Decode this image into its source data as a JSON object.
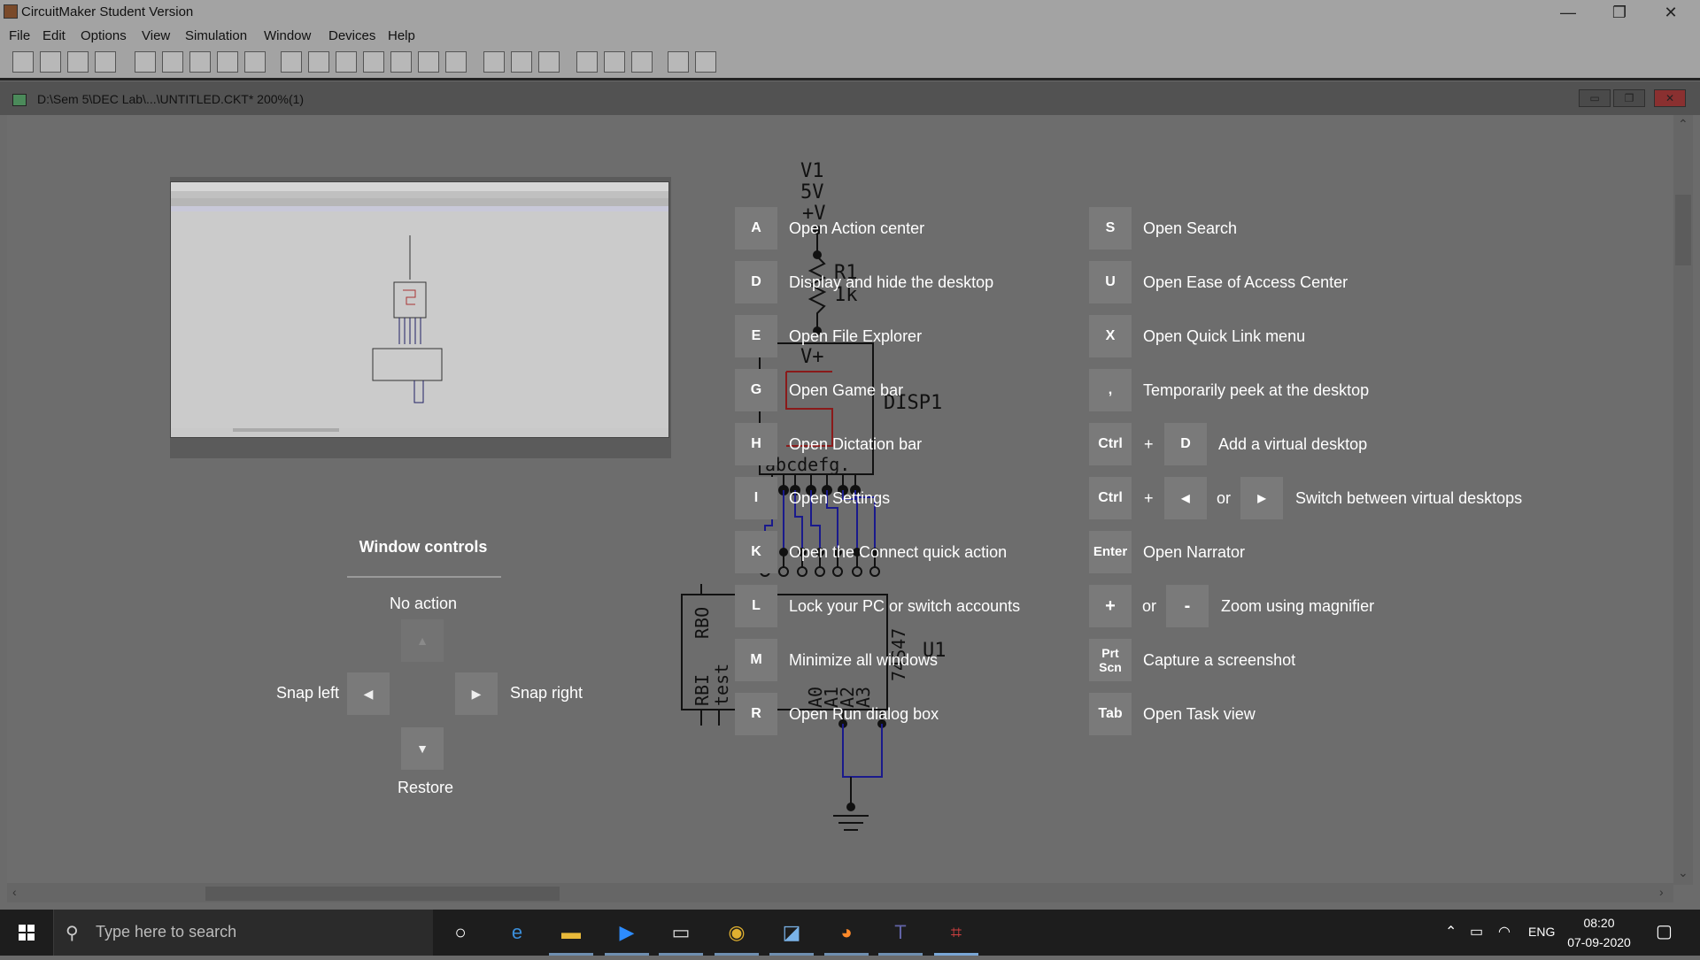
{
  "app": {
    "title": "CircuitMaker Student Version",
    "window_buttons": {
      "minimize": "—",
      "maximize": "❐",
      "close": "✕"
    }
  },
  "menu": [
    "File",
    "Edit",
    "Options",
    "View",
    "Simulation",
    "Window",
    "Devices",
    "Help"
  ],
  "toolbar_icons": [
    "new-icon",
    "open-icon",
    "save-icon",
    "print-icon",
    "pointer-icon",
    "wire-icon",
    "text-icon",
    "probe-icon",
    "zoom-icon",
    "fit-icon",
    "pan-icon",
    "rotate-icon",
    "reset-icon",
    "step-icon",
    "run-icon",
    "stop-icon",
    "find-icon",
    "trace-icon",
    "grid-icon",
    "waveform-icon",
    "analysis-icon",
    "display-icon",
    "help-icon",
    "info-icon"
  ],
  "document": {
    "title": "D:\\Sem 5\\DEC Lab\\...\\UNTITLED.CKT* 200%(1)",
    "buttons": {
      "minimize": "▭",
      "restore": "❐",
      "close": "✕"
    }
  },
  "shortcuts_left": [
    {
      "key": "A",
      "desc": "Open Action center"
    },
    {
      "key": "D",
      "desc": "Display and hide the desktop"
    },
    {
      "key": "E",
      "desc": "Open File Explorer"
    },
    {
      "key": "G",
      "desc": "Open Game bar"
    },
    {
      "key": "H",
      "desc": "Open Dictation bar"
    },
    {
      "key": "I",
      "desc": "Open Settings"
    },
    {
      "key": "K",
      "desc": "Open the Connect quick action"
    },
    {
      "key": "L",
      "desc": "Lock your PC or switch accounts"
    },
    {
      "key": "M",
      "desc": "Minimize all windows"
    },
    {
      "key": "R",
      "desc": "Open Run dialog box"
    }
  ],
  "shortcuts_right": {
    "s": {
      "key": "S",
      "desc": "Open Search"
    },
    "u": {
      "key": "U",
      "desc": "Open Ease of Access Center"
    },
    "x": {
      "key": "X",
      "desc": "Open Quick Link menu"
    },
    "comma": {
      "key": ",",
      "desc": "Temporarily peek at the desktop"
    },
    "add_desktop": {
      "key1": "Ctrl",
      "plus": "+",
      "key2": "D",
      "desc": "Add a virtual desktop"
    },
    "switch_desktop": {
      "key1": "Ctrl",
      "plus": "+",
      "key2": "◀",
      "or": "or",
      "key3": "▶",
      "desc": "Switch between virtual desktops"
    },
    "enter": {
      "key": "Enter",
      "desc": "Open Narrator"
    },
    "zoom": {
      "key1": "+",
      "or": "or",
      "key2": "-",
      "desc": "Zoom using magnifier"
    },
    "prtscn": {
      "key": "Prt Scn",
      "desc": "Capture a screenshot"
    },
    "tab": {
      "key": "Tab",
      "desc": "Open Task view"
    }
  },
  "window_controls": {
    "title": "Window controls",
    "no_action": "No action",
    "snap_left": "Snap left",
    "snap_right": "Snap right",
    "restore": "Restore",
    "up_arrow": "▲",
    "left_arrow": "◀",
    "right_arrow": "▶",
    "down_arrow": "▼"
  },
  "schematic": {
    "v1_name": "V1",
    "v1_value": "5V",
    "v1_terminal": "+V",
    "r1_name": "R1",
    "r1_value": "1k",
    "disp_supply": "V+",
    "disp_name": "DISP1",
    "disp_pins": "abcdefg.",
    "u1_name": "U1",
    "u1_part": "74S47",
    "u1_pin_rbo": "RBO",
    "u1_pin_rbi": "RBI",
    "u1_pin_test": "test",
    "u1_pins_a": [
      "A0",
      "A1",
      "A2",
      "A3"
    ]
  },
  "taskbar": {
    "search_placeholder": "Type here to search",
    "apps": [
      "cortana-icon",
      "edge-icon",
      "file-explorer-icon",
      "zoom-icon",
      "terminal-icon",
      "chrome-icon",
      "app-icon",
      "firefox-icon",
      "teams-icon",
      "circuitmaker-icon"
    ],
    "lang": "ENG",
    "time": "08:20",
    "date": "07-09-2020"
  },
  "colors": {
    "accent": "#7aa7d6",
    "wire_blue": "#1a1a8c",
    "display_red": "#8a1a1a"
  }
}
